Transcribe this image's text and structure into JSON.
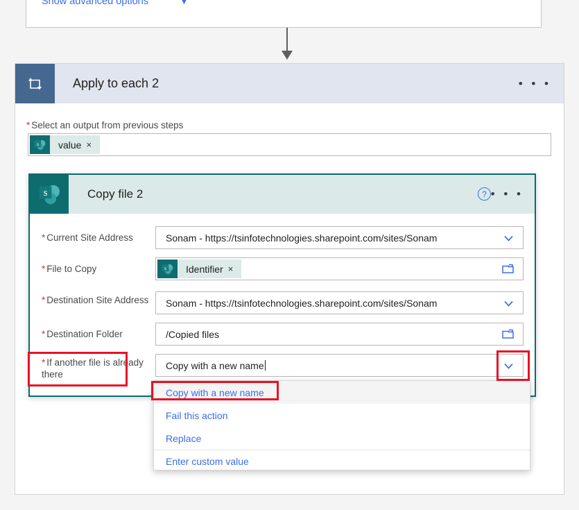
{
  "top_card": {
    "advanced_options_link": "Show advanced options",
    "chevron_icon": "chevron-down-icon"
  },
  "connector": {
    "icon": "down-arrow-icon"
  },
  "apply_to_each": {
    "icon": "loop-repeat-icon",
    "title": "Apply to each 2",
    "more_label": "• • •",
    "field_label": "Select an output from previous steps",
    "required_marker": "*",
    "token": {
      "icon": "sharepoint-icon",
      "label": "value",
      "remove_label": "×"
    }
  },
  "copy_file": {
    "icon": "sharepoint-icon",
    "title": "Copy file 2",
    "help_label": "?",
    "more_label": "• • •",
    "fields": [
      {
        "label": "Current Site Address",
        "required": "*",
        "value": "Sonam - https://tsinfotechnologies.sharepoint.com/sites/Sonam",
        "control": "dropdown",
        "icon": "chevron-down-icon"
      },
      {
        "label": "File to Copy",
        "required": "*",
        "value": "",
        "control": "token-picker",
        "icon": "folder-icon",
        "token": {
          "icon": "sharepoint-icon",
          "label": "Identifier",
          "remove_label": "×"
        }
      },
      {
        "label": "Destination Site Address",
        "required": "*",
        "value": "Sonam - https://tsinfotechnologies.sharepoint.com/sites/Sonam",
        "control": "dropdown",
        "icon": "chevron-down-icon"
      },
      {
        "label": "Destination Folder",
        "required": "*",
        "value": "/Copied files",
        "control": "picker",
        "icon": "folder-icon"
      },
      {
        "label": "If another file is already there",
        "required": "*",
        "value": "Copy with a new name",
        "control": "combo",
        "icon": "chevron-down-icon"
      }
    ]
  },
  "dropdown": {
    "selected": "Copy with a new name",
    "options": [
      {
        "label": "Copy with a new name",
        "selected": true
      },
      {
        "label": "Fail this action",
        "selected": false
      },
      {
        "label": "Replace",
        "selected": false
      }
    ],
    "custom_option": "Enter custom value"
  },
  "colors": {
    "accent_teal": "#0e6c6f",
    "apply_header": "#e1e5ef",
    "apply_icon": "#44688f",
    "copy_header": "#dbeae8",
    "link_blue": "#3a6ee8",
    "required_red": "#d13438",
    "highlight_red": "#e81123",
    "token_bg": "#dceae8"
  }
}
